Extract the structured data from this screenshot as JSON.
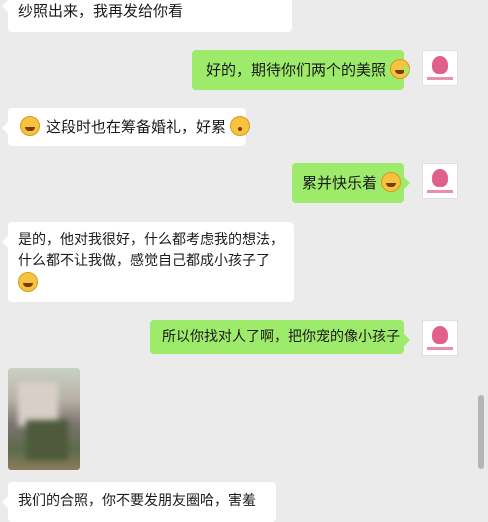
{
  "messages": [
    {
      "text": "纱照出来，我再发给你看"
    },
    {
      "text": "好的，期待你们两个的美照"
    },
    {
      "text": "这段时也在筹备婚礼，好累"
    },
    {
      "text": "累并快乐着"
    },
    {
      "line1": "是的，他对我很好，什么都考虑我的想法，",
      "line2": "什么都不让我做，感觉自己都成小孩子了"
    },
    {
      "text": "所以你找对人了啊，把你宠的像小孩子"
    },
    {
      "text": "我们的合照，你不要发朋友圈哈，害羞"
    }
  ],
  "icons": {
    "heart_eyes": "heart-eyes-emoji",
    "sweat_smile": "sweat-smile-emoji",
    "flushed": "flushed-emoji",
    "grin": "grin-emoji",
    "laugh_cry": "laugh-cry-emoji"
  }
}
